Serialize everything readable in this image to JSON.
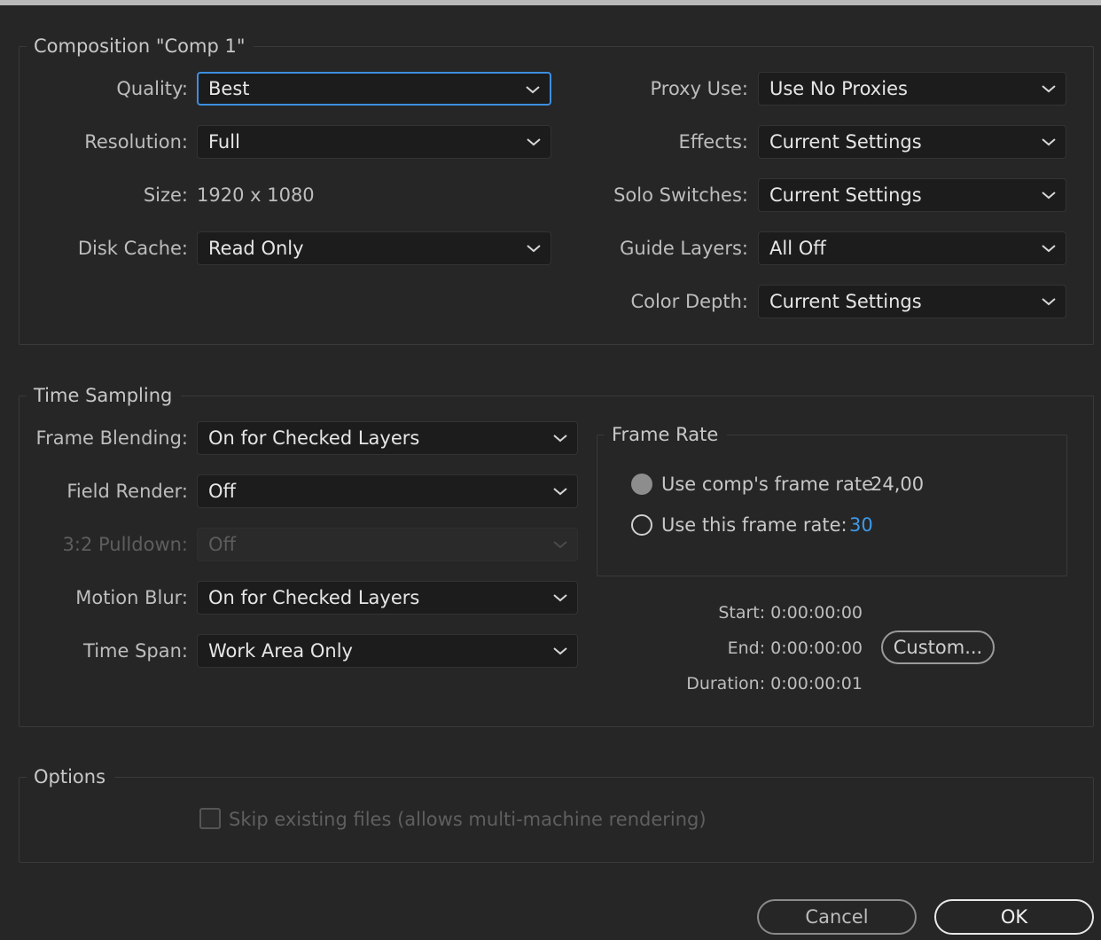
{
  "composition": {
    "title": "Composition \"Comp 1\"",
    "quality": {
      "label": "Quality:",
      "value": "Best"
    },
    "resolution": {
      "label": "Resolution:",
      "value": "Full"
    },
    "size": {
      "label": "Size:",
      "value": "1920 x 1080"
    },
    "disk_cache": {
      "label": "Disk Cache:",
      "value": "Read Only"
    },
    "proxy_use": {
      "label": "Proxy Use:",
      "value": "Use No Proxies"
    },
    "effects": {
      "label": "Effects:",
      "value": "Current Settings"
    },
    "solo_switches": {
      "label": "Solo Switches:",
      "value": "Current Settings"
    },
    "guide_layers": {
      "label": "Guide Layers:",
      "value": "All Off"
    },
    "color_depth": {
      "label": "Color Depth:",
      "value": "Current Settings"
    }
  },
  "time_sampling": {
    "title": "Time Sampling",
    "frame_blending": {
      "label": "Frame Blending:",
      "value": "On for Checked Layers"
    },
    "field_render": {
      "label": "Field Render:",
      "value": "Off"
    },
    "pulldown": {
      "label": "3:2 Pulldown:",
      "value": "Off"
    },
    "motion_blur": {
      "label": "Motion Blur:",
      "value": "On for Checked Layers"
    },
    "time_span": {
      "label": "Time Span:",
      "value": "Work Area Only"
    },
    "frame_rate": {
      "title": "Frame Rate",
      "use_comp_label": "Use comp's frame rate",
      "comp_rate": "24,00",
      "use_this_label": "Use this frame rate:",
      "this_rate": "30",
      "selected": "use_comp"
    },
    "start": "Start: 0:00:00:00",
    "end": "End: 0:00:00:00",
    "duration": "Duration: 0:00:00:01",
    "custom_button": "Custom..."
  },
  "options": {
    "title": "Options",
    "skip_existing": {
      "label": "Skip existing files (allows multi-machine rendering)",
      "checked": false
    }
  },
  "buttons": {
    "cancel": "Cancel",
    "ok": "OK"
  },
  "colors": {
    "background": "#262626",
    "focus": "#3d8ee0",
    "accent_value": "#3d9ae8"
  }
}
